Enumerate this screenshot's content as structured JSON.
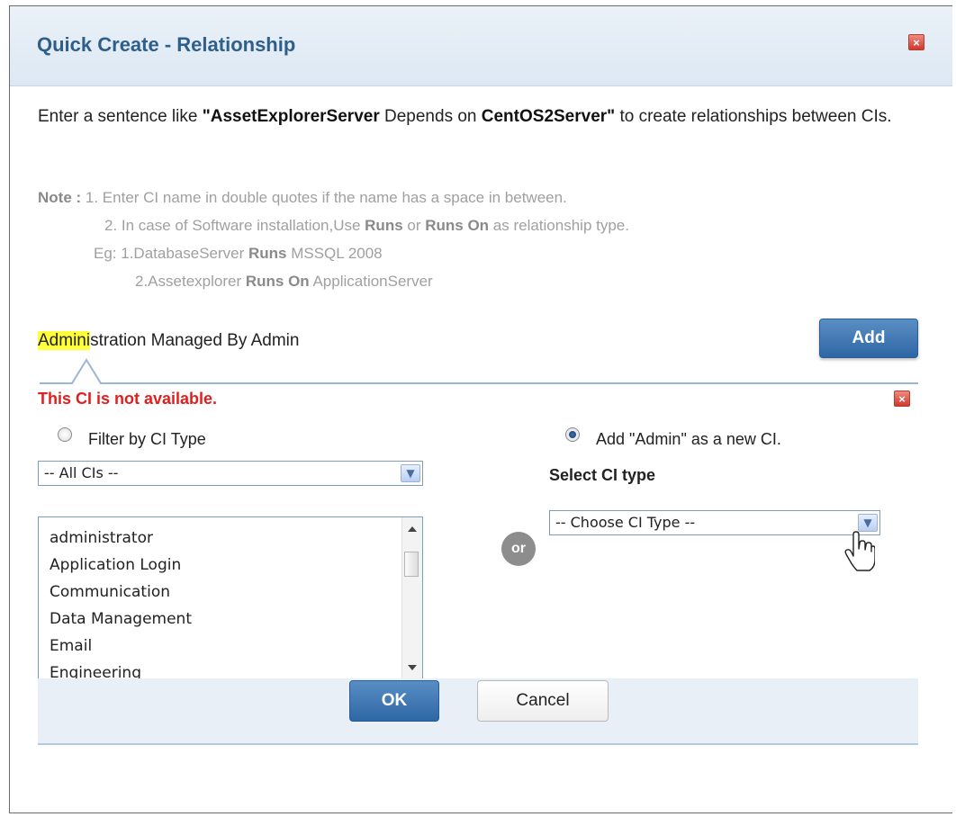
{
  "dialog": {
    "title": "Quick Create - Relationship",
    "close_symbol": "×"
  },
  "intro": {
    "p1": "Enter a sentence like ",
    "b1": "\"AssetExplorerServer",
    "p2": " Depends on ",
    "b2": "CentOS2Server\"",
    "p3": " to create relationships between CIs."
  },
  "note": {
    "label": "Note :",
    "l1": " 1. Enter CI name in double quotes if the name has a space in between.",
    "l2a": "2. In case of Software installation,Use ",
    "l2b": "Runs",
    "l2c": " or ",
    "l2d": "Runs On",
    "l2e": " as relationship type.",
    "l3a": "Eg: 1.DatabaseServer ",
    "l3b": "Runs",
    "l3c": " MSSQL 2008",
    "l4a": "2.Assetexplorer ",
    "l4b": "Runs On",
    "l4c": " ApplicationServer"
  },
  "sentence": {
    "highlight": "Admini",
    "rest": "stration Managed By Admin"
  },
  "add_button": "Add",
  "error_message": "This CI is not available.",
  "filter": {
    "radio_label": "Filter by CI Type",
    "selected": false,
    "select_value": "-- All CIs --",
    "items": [
      "administrator",
      "Application Login",
      "Communication",
      "Data Management",
      "Email",
      "Engineering"
    ]
  },
  "or_label": "or",
  "new_ci": {
    "radio_label": "Add \"Admin\" as a new CI.",
    "selected": true,
    "select_label": "Select CI type",
    "select_value": "-- Choose CI Type --"
  },
  "buttons": {
    "ok": "OK",
    "cancel": "Cancel"
  },
  "icons": [
    "close-icon",
    "dropdown-arrow-icon",
    "hand-cursor-icon"
  ],
  "colors": {
    "title": "#2e5f8a",
    "primary_button": "#2e67a6",
    "error": "#e02020",
    "highlight": "#ffff3a"
  }
}
